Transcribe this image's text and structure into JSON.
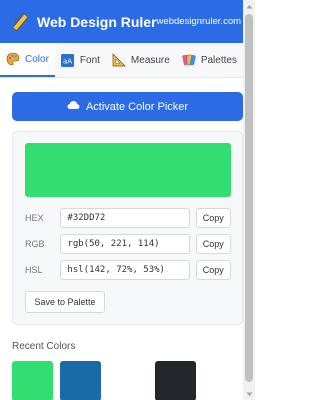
{
  "header": {
    "title": "Web Design Ruler",
    "site_link": "webdesignruler.com",
    "colors": {
      "background": "#2b6ce6",
      "text": "#ffffff"
    },
    "logo_icon": "ruler-icon"
  },
  "tabs": [
    {
      "label": "Color",
      "icon": "palette-icon",
      "active": true
    },
    {
      "label": "Font",
      "icon": "font-icon",
      "active": false
    },
    {
      "label": "Measure",
      "icon": "triangle-ruler-icon",
      "active": false
    },
    {
      "label": "Palettes",
      "icon": "paint-icon",
      "active": false
    }
  ],
  "actions": {
    "activate_label": "Activate Color Picker",
    "activate_icon": "cloud-icon"
  },
  "color": {
    "preview_hex": "#32DD72",
    "rows": [
      {
        "label": "HEX",
        "value": "#32DD72",
        "copy_label": "Copy"
      },
      {
        "label": "RGB",
        "value": "rgb(50, 221, 114)",
        "copy_label": "Copy"
      },
      {
        "label": "HSL",
        "value": "hsl(142, 72%, 53%)",
        "copy_label": "Copy"
      }
    ],
    "save_label": "Save to Palette"
  },
  "recent": {
    "title": "Recent Colors",
    "swatches": [
      "#32DD72",
      "#1a6aa8",
      "#ffffff",
      "#23262b"
    ]
  }
}
